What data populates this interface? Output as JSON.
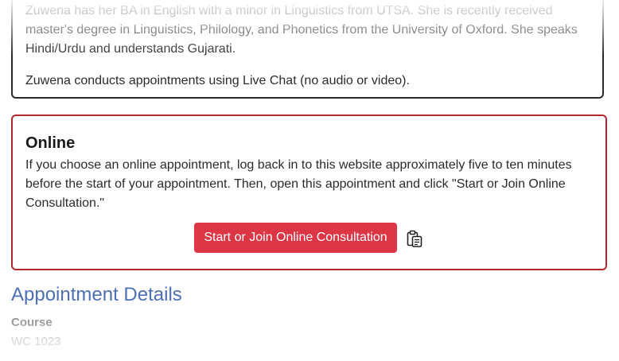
{
  "bio": {
    "text": "Zuwena has her BA in English with a minor in Linguistics from UTSA. She is recently received master's degree in Linguistics, Philology, and Phonetics from the University of Oxford. She speaks Hindi/Urdu and understands Gujarati.",
    "mode": "Zuwena conducts appointments using Live Chat (no audio or video)."
  },
  "online": {
    "title": "Online",
    "instructions": "If you choose an online appointment, log back in to this website approximately five to ten minutes before the start of your appointment. Then, open this appointment and click \"Start or Join Online Consultation.\"",
    "start_button_label": "Start or Join Online Consultation",
    "copy_icon": "clipboard-copy-icon"
  },
  "details": {
    "heading": "Appointment Details",
    "course_label": "Course",
    "course_value": "WC 1023"
  },
  "colors": {
    "primary_button": "#dc3545",
    "online_border": "#b3262d",
    "heading_blue": "#4d6fb5"
  }
}
